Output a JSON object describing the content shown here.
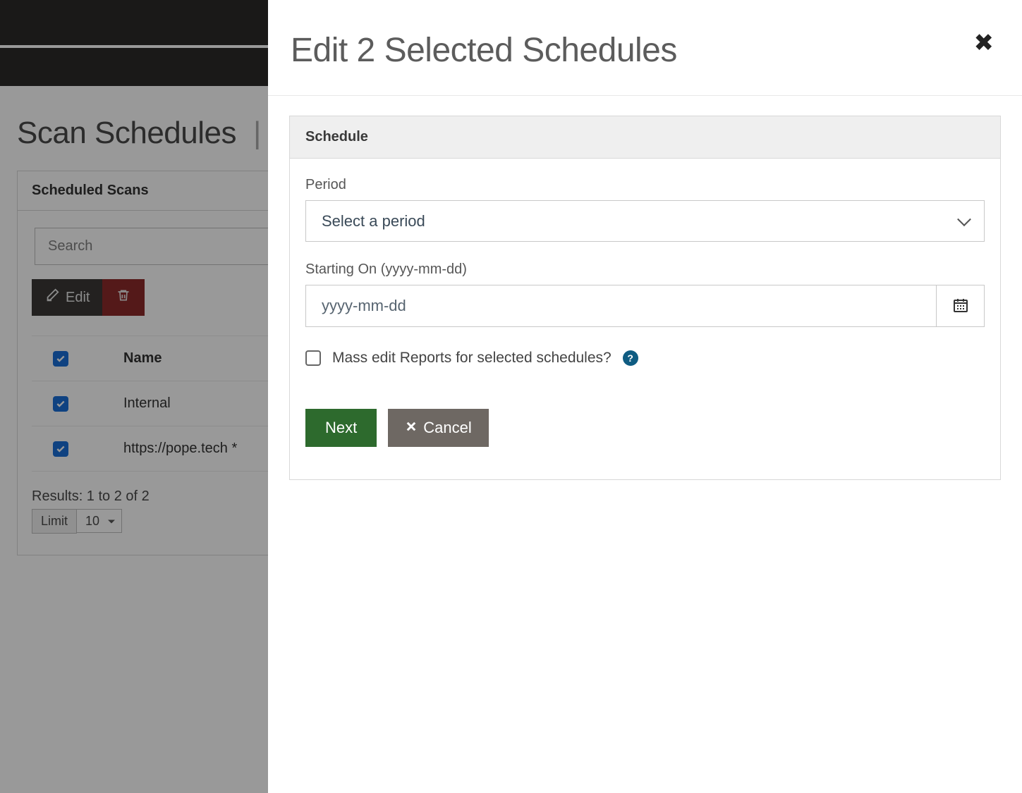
{
  "page": {
    "title": "Scan Schedules"
  },
  "panel": {
    "title": "Scheduled Scans",
    "search_placeholder": "Search",
    "edit_label": "Edit",
    "columns": {
      "name": "Name"
    },
    "rows": [
      {
        "name": "Internal"
      },
      {
        "name": "https://pope.tech *"
      }
    ],
    "results_text": "Results: 1 to 2 of 2",
    "limit_label": "Limit",
    "limit_value": "10"
  },
  "modal": {
    "title": "Edit 2 Selected Schedules",
    "section_title": "Schedule",
    "period_label": "Period",
    "period_placeholder": "Select a period",
    "start_label": "Starting On (yyyy-mm-dd)",
    "start_placeholder": "yyyy-mm-dd",
    "mass_edit_label": "Mass edit Reports for selected schedules?",
    "help_text": "?",
    "next_label": "Next",
    "cancel_label": "Cancel"
  }
}
